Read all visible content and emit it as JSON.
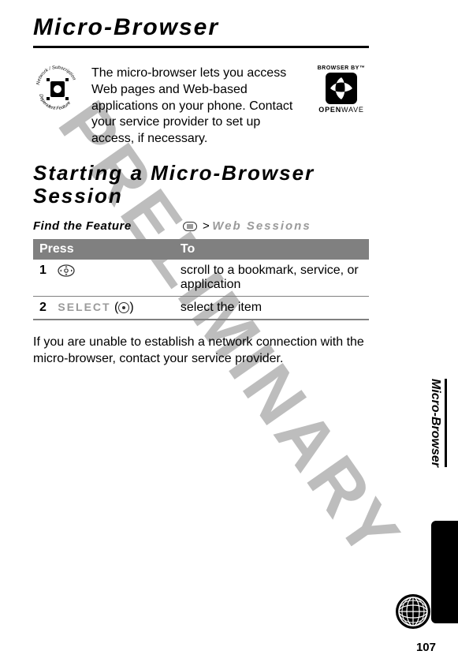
{
  "watermark": "PRELIMINARY",
  "title": "Micro-Browser",
  "intro": "The micro-browser lets you access Web pages and Web-based applications on your phone. Contact your service provider to set up access, if necessary.",
  "openwave": {
    "top": "BROWSER BY",
    "bottom_bold": "OPEN",
    "bottom_light": "WAVE"
  },
  "h2": "Starting a Micro-Browser Session",
  "find_label": "Find the Feature",
  "find_path": "Web Sessions",
  "table": {
    "head_press": "Press",
    "head_to": "To",
    "rows": [
      {
        "num": "1",
        "press_icon": "nav",
        "to": "scroll to a bookmark, service, or application"
      },
      {
        "num": "2",
        "press_label": "SELECT",
        "press_icon": "circ",
        "to": "select the item"
      }
    ]
  },
  "note": "If you are unable to establish a network connection with the micro-browser, contact your service provider.",
  "side_label": "Micro-Browser",
  "page_number": "107"
}
